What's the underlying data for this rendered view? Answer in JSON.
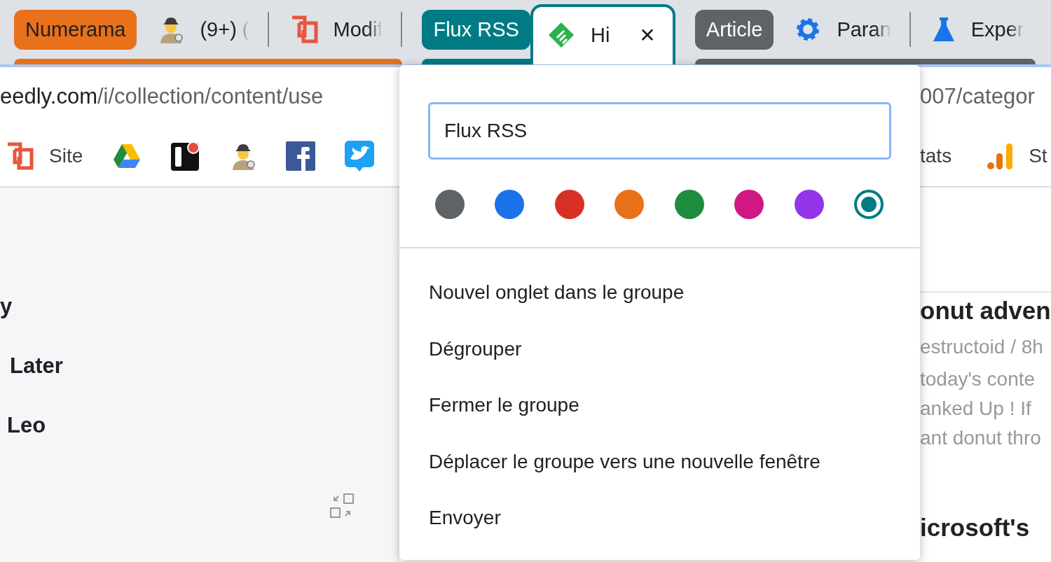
{
  "tab_groups": [
    {
      "label": "Numerama",
      "color": "#e8711a",
      "tabs": [
        {
          "title": "(9+) (",
          "kind": "agent",
          "selected": false
        },
        {
          "title": "Modif",
          "kind": "logo",
          "selected": false
        }
      ]
    },
    {
      "label": "Flux RSS",
      "color": "#007b83",
      "tabs": [
        {
          "title": "Hi",
          "kind": "feed",
          "selected": true,
          "close": "✕"
        }
      ]
    },
    {
      "label": "Article",
      "color": "#5f6368",
      "tabs": [
        {
          "title": "Paran",
          "kind": "gear",
          "selected": false
        },
        {
          "title": "Exper",
          "kind": "flask",
          "selected": false
        }
      ]
    }
  ],
  "address_bar": {
    "url_left_host": "eedly.com",
    "url_left_path": "/i/collection/content/use",
    "url_right": "007/categor"
  },
  "bookmarks": [
    {
      "kind": "logo",
      "label": "Site"
    },
    {
      "kind": "drive"
    },
    {
      "kind": "app"
    },
    {
      "kind": "agent"
    },
    {
      "kind": "facebook"
    },
    {
      "kind": "bird"
    },
    {
      "kind": "text",
      "label": "tats"
    },
    {
      "kind": "bars",
      "label": "St"
    }
  ],
  "sidebar": {
    "items": [
      "y",
      "Later",
      "Leo"
    ]
  },
  "article_list": {
    "title_1": "onut adven",
    "meta": "estructoid / 8h",
    "excerpt": [
      "today's conte",
      "anked Up ! If",
      "ant donut thro"
    ],
    "title_2": "icrosoft's"
  },
  "group_menu": {
    "name_field": "Flux RSS",
    "colors": [
      {
        "color": "#5f6368",
        "selected": false
      },
      {
        "color": "#1a73e8",
        "selected": false
      },
      {
        "color": "#d93025",
        "selected": false
      },
      {
        "color": "#e8711a",
        "selected": false
      },
      {
        "color": "#1e8e3e",
        "selected": false
      },
      {
        "color": "#d01884",
        "selected": false
      },
      {
        "color": "#9334e6",
        "selected": false
      },
      {
        "color": "#007b83",
        "selected": true
      }
    ],
    "items": [
      "Nouvel onglet dans le groupe",
      "Dégrouper",
      "Fermer le groupe",
      "Déplacer le groupe vers une nouvelle fenêtre",
      "Envoyer"
    ]
  }
}
